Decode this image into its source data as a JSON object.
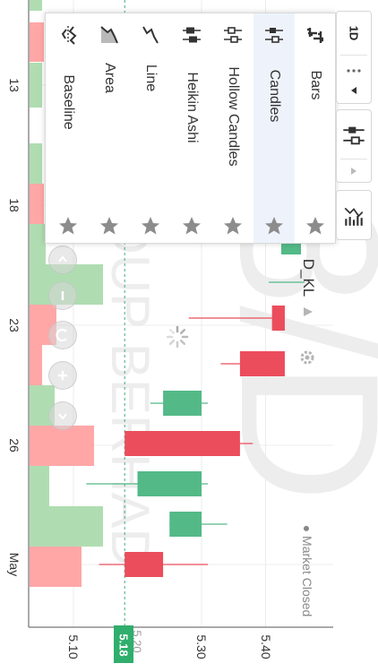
{
  "symbol": "D_KL",
  "market_status": "● Market Closed",
  "watermark": {
    "big": "8/D",
    "company": "GROUP BERHAD"
  },
  "price_axis": {
    "labels": [
      "5.10",
      "5.30",
      "5.40"
    ],
    "current_price": "5.18",
    "ghost_label": "5.20"
  },
  "date_axis": {
    "labels": [
      "13",
      "18",
      "23",
      "26",
      "May"
    ]
  },
  "toolbar": {
    "interval": "1D",
    "more": "⋯",
    "collapse": "◀",
    "expand": "▶",
    "candles_icon": "candles-icon",
    "indicators_icon": "indicators-icon"
  },
  "chart_type_menu": {
    "items": [
      {
        "label": "Bars",
        "icon": "bars-chart-icon",
        "selected": false
      },
      {
        "label": "Candles",
        "icon": "candles-chart-icon",
        "selected": true
      },
      {
        "label": "Hollow Candles",
        "icon": "hollow-candles-icon",
        "selected": false
      },
      {
        "label": "Heikin Ashi",
        "icon": "heikin-ashi-icon",
        "selected": false
      },
      {
        "label": "Line",
        "icon": "line-chart-icon",
        "selected": false
      },
      {
        "label": "Area",
        "icon": "area-chart-icon",
        "selected": false
      },
      {
        "label": "Baseline",
        "icon": "baseline-chart-icon",
        "selected": false
      }
    ]
  },
  "zoom_controls": [
    "zoom-out",
    "zoom-in",
    "reset",
    "scroll-forward",
    "scroll-end"
  ],
  "colors": {
    "up": "#53b987",
    "down": "#eb4d5c",
    "up_volume": "#a6d9a9",
    "down_volume": "#ff9d9d",
    "selected_bg": "#eef3fb",
    "price_badge": "#2fae6d"
  },
  "chart_data": {
    "type": "candlestick",
    "orientation": "rotated 90° clockwise (time runs top to bottom, price increases to the right)",
    "y_axis_ticks": [
      5.1,
      5.3,
      5.4
    ],
    "current_price": 5.18,
    "candles": [
      {
        "x": "23",
        "open": 5.43,
        "close": 5.41,
        "high": 5.43,
        "low": 5.28,
        "dir": "down"
      },
      {
        "x": "24",
        "open": 5.43,
        "close": 5.36,
        "high": 5.43,
        "low": 5.33,
        "dir": "down"
      },
      {
        "x": "25",
        "open": 5.24,
        "close": 5.3,
        "high": 5.31,
        "low": 5.22,
        "dir": "up"
      },
      {
        "x": "26",
        "open": 5.36,
        "close": 5.18,
        "high": 5.38,
        "low": 5.18,
        "dir": "down"
      },
      {
        "x": "29",
        "open": 5.2,
        "close": 5.3,
        "high": 5.31,
        "low": 5.12,
        "dir": "up"
      },
      {
        "x": "30",
        "open": 5.25,
        "close": 5.3,
        "high": 5.34,
        "low": 5.25,
        "dir": "up"
      },
      {
        "x": "May",
        "open": 5.24,
        "close": 5.18,
        "high": 5.31,
        "low": 5.14,
        "dir": "down"
      }
    ]
  }
}
